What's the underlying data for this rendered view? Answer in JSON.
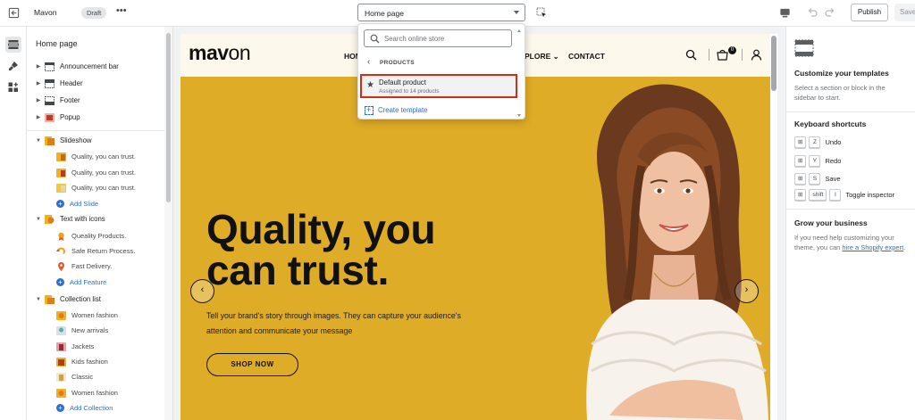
{
  "topbar": {
    "store_name": "Mavon",
    "status_badge": "Draft",
    "more_label": "•••",
    "page_selector": "Home page",
    "publish_label": "Publish",
    "save_label": "Save"
  },
  "sidebar": {
    "title": "Home page",
    "header_groups": [
      {
        "label": "Announcement bar",
        "icon": "section-icon"
      },
      {
        "label": "Header",
        "icon": "header-icon"
      },
      {
        "label": "Footer",
        "icon": "footer-icon"
      },
      {
        "label": "Popup",
        "icon": "popup-icon"
      }
    ],
    "sections": [
      {
        "label": "Slideshow",
        "children": [
          "Quality, you can trust.",
          "Quality, you can trust.",
          "Quality, you can trust."
        ],
        "add_label": "Add Slide"
      },
      {
        "label": "Text with icons",
        "children": [
          "Queality Products.",
          "Safe Return Process.",
          "Fast Delivery."
        ],
        "add_label": "Add Feature"
      },
      {
        "label": "Collection list",
        "children": [
          "Women fashion",
          "New arrivals",
          "Jackets",
          "Kids fashion",
          "Classic",
          "Women fashion"
        ],
        "add_label": "Add Collection"
      }
    ]
  },
  "preview": {
    "logo_bold": "mav",
    "logo_light": "on",
    "nav": [
      "HOM",
      "PLORE",
      "CONTACT"
    ],
    "cart_count": "0",
    "hero_title": "Quality, you can trust.",
    "hero_desc": "Tell your brand's story through images. They can capture your audience's attention and communicate your message",
    "hero_button": "SHOP NOW",
    "hero_bg": "#dfac27"
  },
  "dropdown": {
    "search_placeholder": "Search online store",
    "back_label": "PRODUCTS",
    "option_name": "Default product",
    "option_sub": "Assigned to 14 products",
    "create_label": "Create template"
  },
  "right_panel": {
    "customize_title": "Customize your templates",
    "customize_desc": "Select a section or block in the sidebar to start.",
    "shortcuts_title": "Keyboard shortcuts",
    "shortcuts": [
      {
        "keys": [
          "⊞",
          "Z"
        ],
        "label": "Undo"
      },
      {
        "keys": [
          "⊞",
          "Y"
        ],
        "label": "Redo"
      },
      {
        "keys": [
          "⊞",
          "S"
        ],
        "label": "Save"
      },
      {
        "keys": [
          "⊞",
          "shift",
          "I"
        ],
        "label": "Toggle inspector"
      }
    ],
    "grow_title": "Grow your business",
    "grow_desc": "If you need help customizing your theme, you can ",
    "grow_link": "hire a Shopify expert",
    "grow_end": "."
  },
  "colors": {
    "accent": "#2c6ecb",
    "highlight": "#d72c0d",
    "hero_yellow": "#dfac27"
  }
}
